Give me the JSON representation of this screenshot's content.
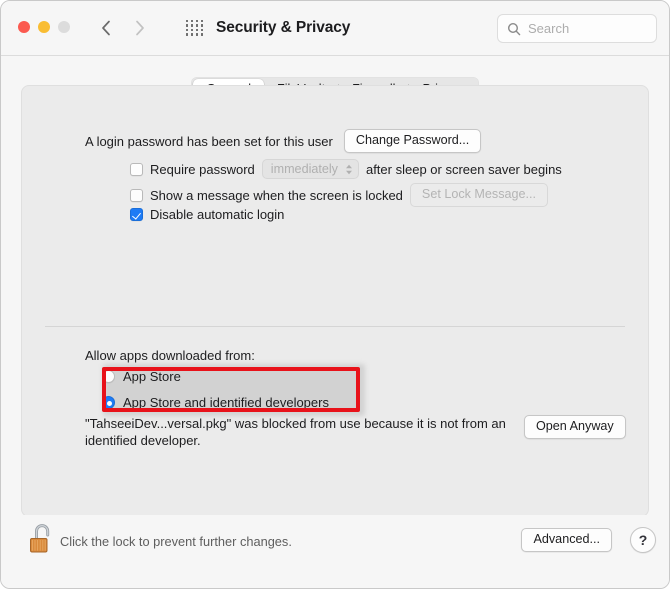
{
  "window": {
    "title": "Security & Privacy",
    "traffic_lights": [
      {
        "name": "close",
        "color": "#fb5a50"
      },
      {
        "name": "minimize",
        "color": "#f9bd33"
      },
      {
        "name": "zoom",
        "color": "#dcdcdc"
      }
    ]
  },
  "search": {
    "value": "",
    "placeholder": "Search"
  },
  "tabs": [
    {
      "label": "General",
      "selected": true
    },
    {
      "label": "FileVault",
      "selected": false
    },
    {
      "label": "Firewall",
      "selected": false
    },
    {
      "label": "Privacy",
      "selected": false
    }
  ],
  "general": {
    "password_status": "A login password has been set for this user",
    "change_password_label": "Change Password...",
    "require_password": {
      "label": "Require password",
      "checked": false,
      "interval_value": "immediately",
      "suffix": "after sleep or screen saver begins",
      "enabled": false
    },
    "show_message": {
      "label": "Show a message when the screen is locked",
      "checked": false,
      "button_label": "Set Lock Message...",
      "button_enabled": false
    },
    "disable_automatic_login": {
      "label": "Disable automatic login",
      "checked": true
    }
  },
  "gatekeeper": {
    "section_label": "Allow apps downloaded from:",
    "options": [
      {
        "label": "App Store",
        "selected": false
      },
      {
        "label": "App Store and identified developers",
        "selected": true
      }
    ],
    "blocked_message": "\"TahseeiDev...versal.pkg\" was blocked from use because it is not from an identified developer.",
    "open_anyway_label": "Open Anyway"
  },
  "highlight": {
    "color": "#e8121a",
    "target": "gatekeeper-radio-group"
  },
  "bottom_bar": {
    "lock_state": "unlocked",
    "lock_caption": "Click the lock to prevent further changes.",
    "advanced_label": "Advanced...",
    "help_label": "?"
  }
}
